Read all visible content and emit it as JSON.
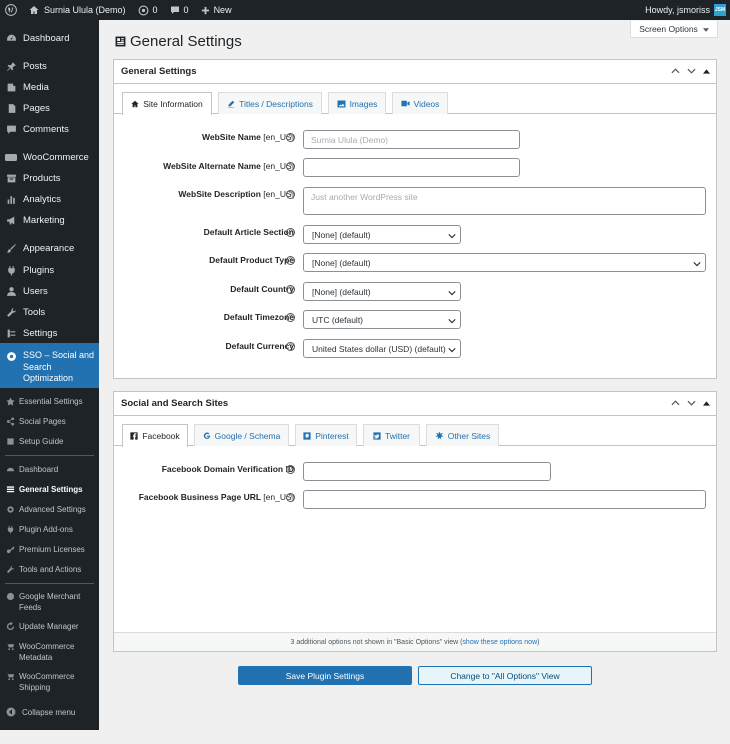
{
  "admin_bar": {
    "site_name": "Surnia Ulula (Demo)",
    "updates_count": "0",
    "comments_count": "0",
    "new_label": "New",
    "howdy": "Howdy, jsmoriss",
    "avatar_text": "JSM"
  },
  "sidebar": {
    "menu": {
      "dashboard": "Dashboard",
      "posts": "Posts",
      "media": "Media",
      "pages": "Pages",
      "comments": "Comments",
      "woocommerce": "WooCommerce",
      "products": "Products",
      "analytics": "Analytics",
      "marketing": "Marketing",
      "appearance": "Appearance",
      "plugins": "Plugins",
      "users": "Users",
      "tools": "Tools",
      "settings": "Settings",
      "sso": "SSO – Social and Search Optimization"
    },
    "sub": {
      "essential": "Essential Settings",
      "social_pages": "Social Pages",
      "setup_guide": "Setup Guide",
      "dashboard": "Dashboard",
      "general": "General Settings",
      "advanced": "Advanced Settings",
      "addons": "Plugin Add-ons",
      "licenses": "Premium Licenses",
      "tools_actions": "Tools and Actions",
      "gmf": "Google Merchant Feeds",
      "update_manager": "Update Manager",
      "woo_metadata": "WooCommerce Metadata",
      "woo_shipping": "WooCommerce Shipping"
    },
    "collapse": "Collapse menu"
  },
  "screen_options": "Screen Options",
  "page_title": "General Settings",
  "general_box": {
    "title": "General Settings",
    "tabs": [
      "Site Information",
      "Titles / Descriptions",
      "Images",
      "Videos"
    ],
    "fields": {
      "site_name": {
        "label": "WebSite Name",
        "locale": "[en_US]",
        "placeholder": "Surnia Ulula (Demo)"
      },
      "alt_name": {
        "label": "WebSite Alternate Name",
        "locale": "[en_US]",
        "value": ""
      },
      "description": {
        "label": "WebSite Description",
        "locale": "[en_US]",
        "placeholder": "Just another WordPress site"
      },
      "article_section": {
        "label": "Default Article Section",
        "value": "[None] (default)"
      },
      "product_type": {
        "label": "Default Product Type",
        "value": "[None] (default)"
      },
      "country": {
        "label": "Default Country",
        "value": "[None] (default)"
      },
      "timezone": {
        "label": "Default Timezone",
        "value": "UTC (default)"
      },
      "currency": {
        "label": "Default Currency",
        "value": "United States dollar (USD) (default)"
      }
    }
  },
  "social_box": {
    "title": "Social and Search Sites",
    "tabs": [
      "Facebook",
      "Google / Schema",
      "Pinterest",
      "Twitter",
      "Other Sites"
    ],
    "fields": {
      "fb_verification": {
        "label": "Facebook Domain Verification ID",
        "value": ""
      },
      "fb_page_url": {
        "label": "Facebook Business Page URL",
        "locale": "[en_US]",
        "value": ""
      }
    },
    "footer_text": "3 additional options not shown in \"Basic Options\" view (",
    "footer_link": "show these options now",
    "footer_end": ")"
  },
  "buttons": {
    "save": "Save Plugin Settings",
    "change_view": "Change to \"All Options\" View"
  },
  "colors": {
    "admin_dark": "#1d2327",
    "accent": "#2271b1",
    "background": "#f0f0f1"
  }
}
